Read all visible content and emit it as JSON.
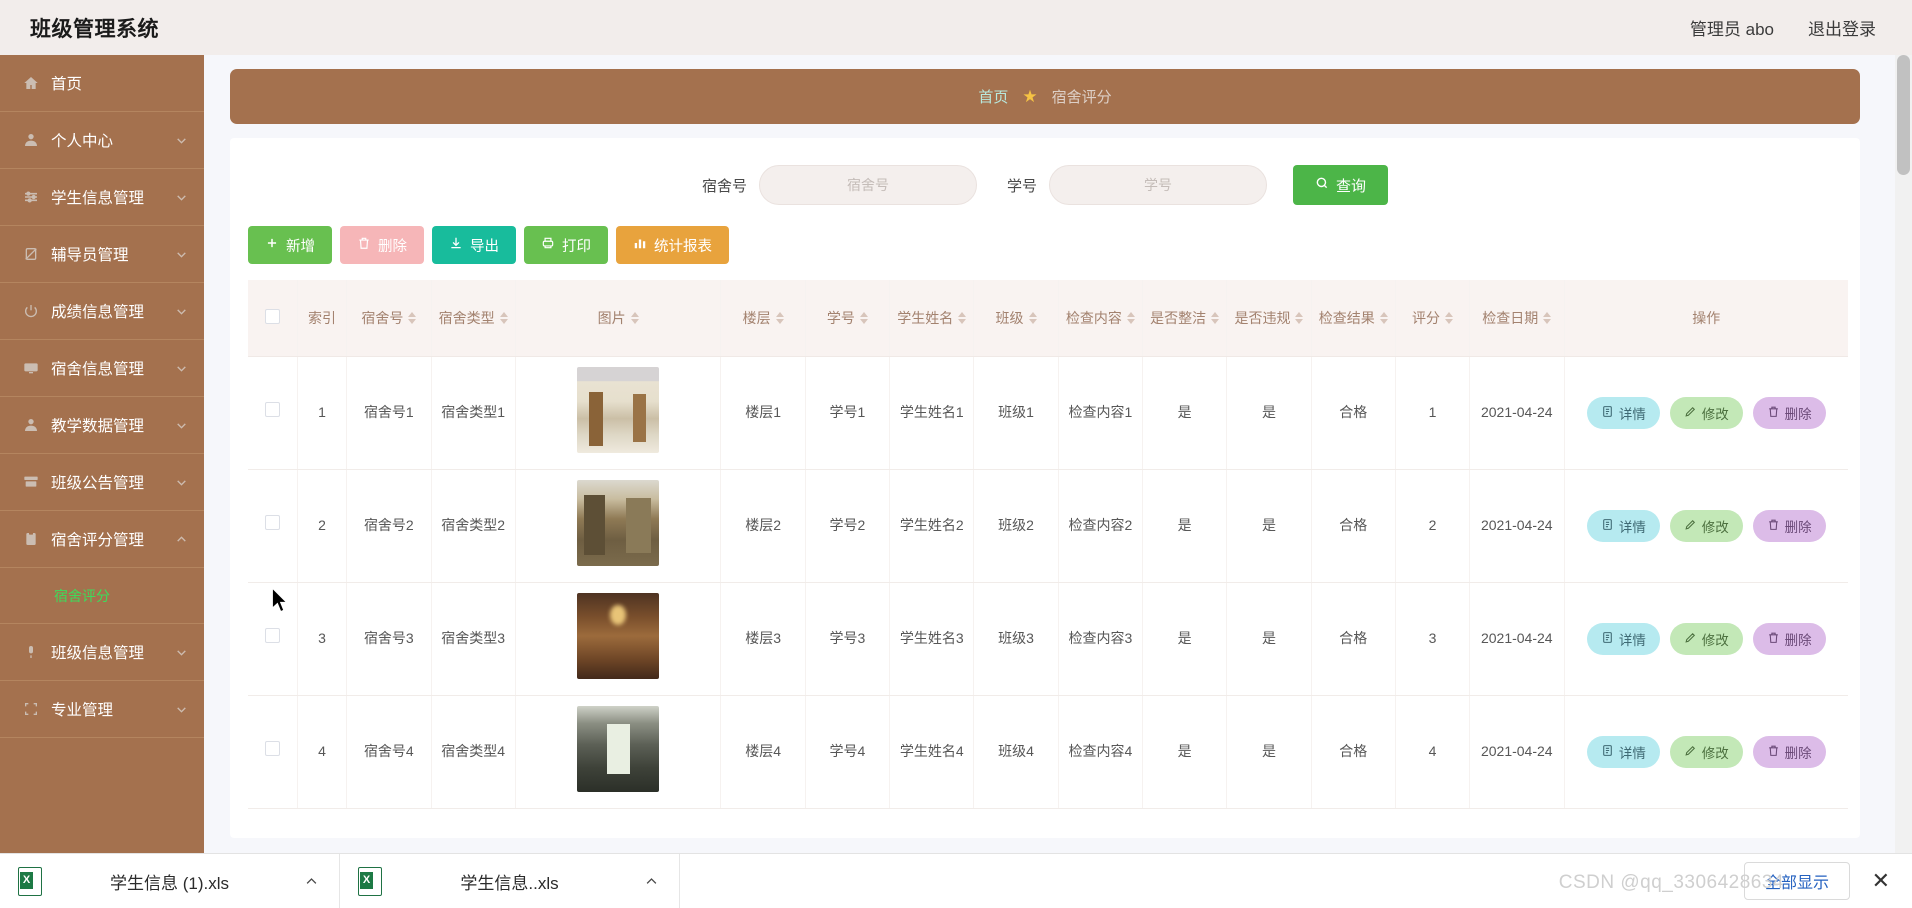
{
  "header": {
    "brand": "班级管理系统",
    "user": "管理员 abo",
    "logout": "退出登录"
  },
  "sidebar": {
    "items": [
      {
        "label": "首页",
        "icon": "home-icon",
        "arrow": "",
        "active": false
      },
      {
        "label": "个人中心",
        "icon": "user-icon",
        "arrow": "chevron-down-icon"
      },
      {
        "label": "学生信息管理",
        "icon": "sliders-icon",
        "arrow": "chevron-down-icon"
      },
      {
        "label": "辅导员管理",
        "icon": "badge-icon",
        "arrow": "chevron-down-icon"
      },
      {
        "label": "成绩信息管理",
        "icon": "power-icon",
        "arrow": "chevron-down-icon"
      },
      {
        "label": "宿舍信息管理",
        "icon": "monitor-icon",
        "arrow": "chevron-down-icon"
      },
      {
        "label": "教学数据管理",
        "icon": "user-icon",
        "arrow": "chevron-down-icon"
      },
      {
        "label": "班级公告管理",
        "icon": "archive-icon",
        "arrow": "chevron-down-icon"
      },
      {
        "label": "宿舍评分管理",
        "icon": "clipboard-icon",
        "arrow": "chevron-up-icon",
        "expanded": true
      },
      {
        "label": "班级信息管理",
        "icon": "mic-icon",
        "arrow": "chevron-down-icon"
      },
      {
        "label": "专业管理",
        "icon": "square-icon",
        "arrow": "chevron-down-icon"
      }
    ],
    "submenu": {
      "label": "宿舍评分",
      "parent": "宿舍评分管理",
      "color": "#3ddc5a"
    }
  },
  "breadcrumb": {
    "home": "首页",
    "separator_icon": "star-icon",
    "current": "宿舍评分"
  },
  "search": {
    "fields": [
      {
        "label": "宿舍号",
        "placeholder": "宿舍号",
        "value": ""
      },
      {
        "label": "学号",
        "placeholder": "学号",
        "value": ""
      }
    ],
    "button": {
      "label": "查询",
      "icon": "search-icon",
      "color": "#4cb548"
    }
  },
  "toolbar": {
    "buttons": [
      {
        "label": "新增",
        "icon": "plus-icon",
        "color": "#68c050"
      },
      {
        "label": "删除",
        "icon": "trash-icon",
        "color": "#f6b6b8"
      },
      {
        "label": "导出",
        "icon": "download-icon",
        "color": "#18bc9c"
      },
      {
        "label": "打印",
        "icon": "printer-icon",
        "color": "#68c050"
      },
      {
        "label": "统计报表",
        "icon": "chart-bar-icon",
        "color": "#e8a33d"
      }
    ]
  },
  "table": {
    "columns": [
      {
        "key": "check",
        "label": "",
        "sortable": false
      },
      {
        "key": "index",
        "label": "索引",
        "sortable": false
      },
      {
        "key": "dorm_no",
        "label": "宿舍号",
        "sortable": true
      },
      {
        "key": "dorm_type",
        "label": "宿舍类型",
        "sortable": true
      },
      {
        "key": "image",
        "label": "图片",
        "sortable": true
      },
      {
        "key": "floor",
        "label": "楼层",
        "sortable": true
      },
      {
        "key": "student_no",
        "label": "学号",
        "sortable": true
      },
      {
        "key": "student_name",
        "label": "学生姓名",
        "sortable": true
      },
      {
        "key": "class",
        "label": "班级",
        "sortable": true
      },
      {
        "key": "check_content",
        "label": "检查内容",
        "sortable": true
      },
      {
        "key": "is_clean",
        "label": "是否整洁",
        "sortable": true
      },
      {
        "key": "is_violation",
        "label": "是否违规",
        "sortable": true
      },
      {
        "key": "check_result",
        "label": "检查结果",
        "sortable": true
      },
      {
        "key": "score",
        "label": "评分",
        "sortable": true
      },
      {
        "key": "check_date",
        "label": "检查日期",
        "sortable": true
      },
      {
        "key": "ops",
        "label": "操作",
        "sortable": false
      }
    ],
    "rows": [
      {
        "index": "1",
        "dorm_no": "宿舍号1",
        "dorm_type": "宿舍类型1",
        "image": "dorm-photo-1",
        "floor": "楼层1",
        "student_no": "学号1",
        "student_name": "学生姓名1",
        "class": "班级1",
        "check_content": "检查内容1",
        "is_clean": "是",
        "is_violation": "是",
        "check_result": "合格",
        "score": "1",
        "check_date": "2021-04-24"
      },
      {
        "index": "2",
        "dorm_no": "宿舍号2",
        "dorm_type": "宿舍类型2",
        "image": "dorm-photo-2",
        "floor": "楼层2",
        "student_no": "学号2",
        "student_name": "学生姓名2",
        "class": "班级2",
        "check_content": "检查内容2",
        "is_clean": "是",
        "is_violation": "是",
        "check_result": "合格",
        "score": "2",
        "check_date": "2021-04-24"
      },
      {
        "index": "3",
        "dorm_no": "宿舍号3",
        "dorm_type": "宿舍类型3",
        "image": "dorm-photo-3",
        "floor": "楼层3",
        "student_no": "学号3",
        "student_name": "学生姓名3",
        "class": "班级3",
        "check_content": "检查内容3",
        "is_clean": "是",
        "is_violation": "是",
        "check_result": "合格",
        "score": "3",
        "check_date": "2021-04-24"
      },
      {
        "index": "4",
        "dorm_no": "宿舍号4",
        "dorm_type": "宿舍类型4",
        "image": "dorm-photo-4",
        "floor": "楼层4",
        "student_no": "学号4",
        "student_name": "学生姓名4",
        "class": "班级4",
        "check_content": "检查内容4",
        "is_clean": "是",
        "is_violation": "是",
        "check_result": "合格",
        "score": "4",
        "check_date": "2021-04-24"
      }
    ],
    "row_actions": [
      {
        "label": "详情",
        "icon": "file-text-icon",
        "color": "#b6eaf0"
      },
      {
        "label": "修改",
        "icon": "pencil-icon",
        "color": "#c3e8b7"
      },
      {
        "label": "删除",
        "icon": "trash-icon",
        "color": "#dcbce8"
      }
    ]
  },
  "downloads": {
    "items": [
      {
        "name": "学生信息 (1).xls",
        "icon": "excel-icon",
        "caret": "chevron-up-icon"
      },
      {
        "name": "学生信息..xls",
        "icon": "excel-icon",
        "caret": "chevron-up-icon"
      }
    ],
    "show_all": "全部显示",
    "close_icon": "close-icon"
  },
  "watermark": "CSDN @qq_3306428634",
  "colors": {
    "brand_brown": "#a4714e",
    "header_bg": "#f2edeb",
    "accent_green": "#4cb548",
    "submenu_green": "#3ddc5a",
    "table_header_bg": "#f9f3f1",
    "table_header_text": "#a3826f"
  }
}
